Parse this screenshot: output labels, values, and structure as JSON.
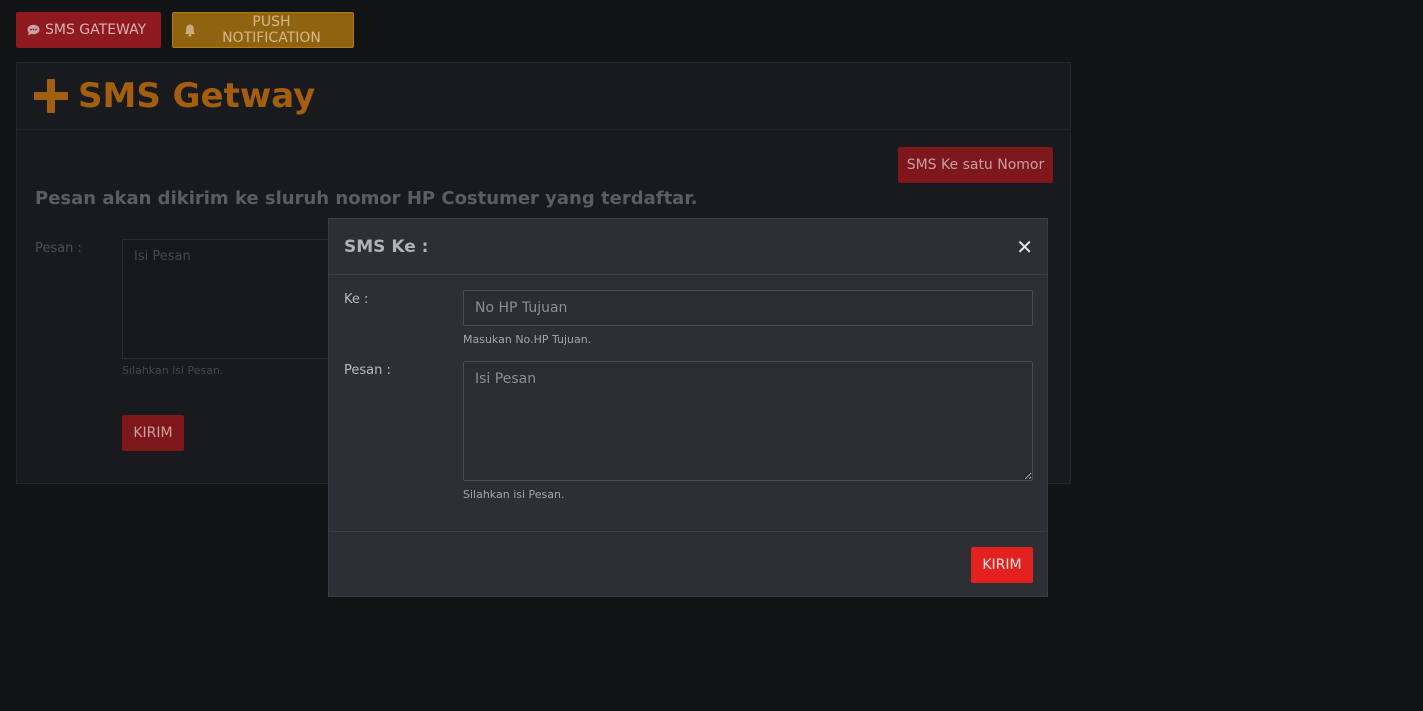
{
  "topbar": {
    "sms_gateway_label": "SMS GATEWAY",
    "push_notification_label": "PUSH NOTIFICATION"
  },
  "card": {
    "title": "SMS Getway",
    "sms_one_button": "SMS Ke satu Nomor",
    "description": "Pesan akan dikirim ke sluruh nomor HP Costumer yang terdaftar.",
    "pesan_label": "Pesan :",
    "pesan_placeholder": "Isi Pesan",
    "pesan_help": "Silahkan isi Pesan.",
    "submit_label": "KIRIM"
  },
  "modal": {
    "title": "SMS Ke :",
    "close_glyph": "✕",
    "ke_label": "Ke :",
    "ke_placeholder": "No HP Tujuan",
    "ke_help": "Masukan No.HP Tujuan.",
    "pesan_label": "Pesan :",
    "pesan_placeholder": "Isi Pesan",
    "pesan_help": "Silahkan isi Pesan.",
    "submit_label": "KIRIM"
  },
  "colors": {
    "background": "#121315",
    "red": "#e3211f",
    "orange": "#a35e10",
    "modal": "#2d2f34"
  }
}
